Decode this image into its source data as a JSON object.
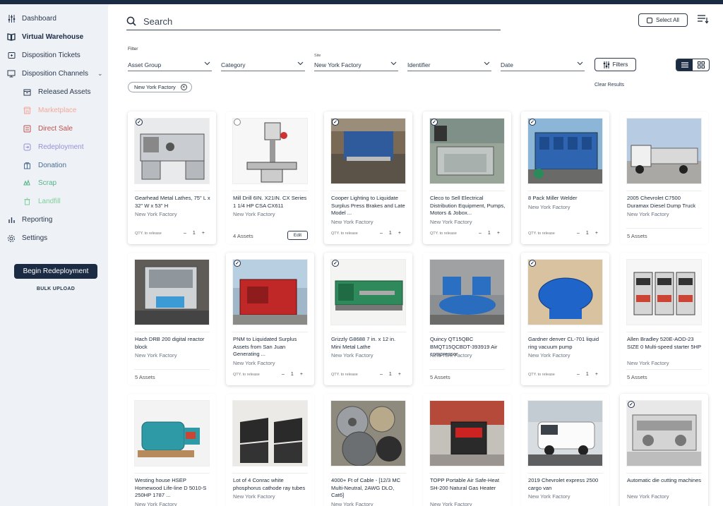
{
  "sidebar": {
    "items": [
      {
        "label": "Dashboard",
        "icon": "sliders-icon",
        "name": "dashboard",
        "level": "top",
        "color": "#2b3a4e"
      },
      {
        "label": "Virtual Warehouse",
        "icon": "book-icon",
        "name": "virtual-warehouse",
        "level": "top",
        "active": true,
        "color": "#1b2b44"
      },
      {
        "label": "Disposition Tickets",
        "icon": "ticket-icon",
        "name": "disposition-tickets",
        "level": "top",
        "color": "#2b3a4e"
      },
      {
        "label": "Disposition Channels",
        "icon": "monitor-icon",
        "name": "disposition-channels",
        "level": "top",
        "chevron": true,
        "color": "#2b3a4e"
      },
      {
        "label": "Released Assets",
        "icon": "box-icon",
        "name": "released-assets",
        "level": "sub",
        "color": "#2b3a4e"
      },
      {
        "label": "Marketplace",
        "icon": "store-icon",
        "name": "marketplace",
        "level": "sub",
        "color": "#f2a99a"
      },
      {
        "label": "Direct Sale",
        "icon": "tag-icon",
        "name": "direct-sale",
        "level": "sub",
        "color": "#c0504d"
      },
      {
        "label": "Redeployment",
        "icon": "redeploy-icon",
        "name": "redeployment",
        "level": "sub",
        "color": "#9b8fd8"
      },
      {
        "label": "Donation",
        "icon": "donation-icon",
        "name": "donation",
        "level": "sub",
        "color": "#4a6d93"
      },
      {
        "label": "Scrap",
        "icon": "recycle-icon",
        "name": "scrap",
        "level": "sub",
        "color": "#56b58a"
      },
      {
        "label": "Landfill",
        "icon": "trash-icon",
        "name": "landfill",
        "level": "sub",
        "color": "#7fd09a"
      },
      {
        "label": "Reporting",
        "icon": "bar-chart-icon",
        "name": "reporting",
        "level": "top",
        "color": "#2b3a4e"
      },
      {
        "label": "Settings",
        "icon": "gear-icon",
        "name": "settings",
        "level": "top",
        "color": "#2b3a4e"
      }
    ],
    "begin_label": "Begin Redeployment",
    "bulk_label": "BULK UPLOAD"
  },
  "search": {
    "placeholder": "Search"
  },
  "toolbar": {
    "select_all_label": "Select All",
    "filters_label": "Filters",
    "clear_label": "Clear Results"
  },
  "filter": {
    "label": "Filter",
    "dropdowns": [
      {
        "name": "asset-group",
        "value": "Asset Group",
        "top_label": ""
      },
      {
        "name": "category",
        "value": "Category",
        "top_label": ""
      },
      {
        "name": "site",
        "value": "New York Factory",
        "top_label": "Site"
      },
      {
        "name": "identifier",
        "value": "Identifier",
        "top_label": ""
      },
      {
        "name": "date",
        "value": "Date",
        "top_label": ""
      }
    ],
    "chip": "New York Factory"
  },
  "cards": [
    {
      "title": "Gearhead Metal Lathes, 75\" L x 32\" W x 53\" H",
      "location": "New York Factory",
      "mode": "qty",
      "checked": true,
      "qty_label": "QTY. to release",
      "qty": "1",
      "img": "lathe"
    },
    {
      "title": "Mill Drill 6IN. X21IN. CX Series 1 1/4 HP CSA CX611",
      "location": "New York Factory",
      "mode": "edit",
      "checked": false,
      "assets": "4 Assets",
      "edit_label": "Edit",
      "img": "drill"
    },
    {
      "title": "Cooper Lighting to Liquidate Surplus Press Brakes and Late Model ...",
      "location": "New York Factory",
      "mode": "qty",
      "checked": true,
      "qty_label": "QTY. to release",
      "qty": "1",
      "img": "press"
    },
    {
      "title": "Cleco to Sell Electrical Distribution Equipment, Pumps, Motors & Jobox...",
      "location": "New York Factory",
      "mode": "qty",
      "checked": true,
      "qty_label": "QTY. to release",
      "qty": "1",
      "img": "table"
    },
    {
      "title": "8 Pack Miller Welder",
      "location": "New York Factory",
      "mode": "qty",
      "checked": true,
      "qty_label": "QTY. to release",
      "qty": "1",
      "img": "welder"
    },
    {
      "title": "2005 Chevrolet C7500 Duramax Diesel Dump Truck",
      "location": "New York Factory",
      "mode": "assets",
      "checked": false,
      "assets": "5 Assets",
      "img": "truck"
    },
    {
      "title": "Hach DRB 200 digital reactor block",
      "location": "New York Factory",
      "mode": "assets",
      "checked": false,
      "assets": "5 Assets",
      "img": "reactor"
    },
    {
      "title": "PNM to Liquidated Surplus Assets from San Juan Generating ...",
      "location": "New York Factory",
      "mode": "qty",
      "checked": true,
      "qty_label": "QTY. to release",
      "qty": "1",
      "img": "generator"
    },
    {
      "title": "Grizzly G8688 7 in. x 12 in. Mini Metal Lathe",
      "location": "New York Factory",
      "mode": "qty",
      "checked": true,
      "qty_label": "QTY. to release",
      "qty": "1",
      "img": "minilathe"
    },
    {
      "title": "Quincy QT15QBC BMQT15QCBDT-393919 Air compressor",
      "location": "New York Factory",
      "mode": "assets",
      "checked": false,
      "assets": "5 Assets",
      "img": "compressor"
    },
    {
      "title": "Gardner denver CL-701 liquid ring vacuum pump",
      "location": "New York Factory",
      "mode": "qty",
      "checked": true,
      "qty_label": "QTY. to release",
      "qty": "1",
      "img": "pump"
    },
    {
      "title": "Allen Bradley 520E-AOD-23 SIZE 0 Multi-speed starter 5HP",
      "location": "New York Factory",
      "mode": "assets",
      "checked": false,
      "assets": "5 Assets",
      "img": "starter"
    },
    {
      "title": "Westing house HSEP Homewood Life-line D 5010-S 250HP 1787 ...",
      "location": "New York Factory",
      "mode": "none",
      "checked": false,
      "img": "motor"
    },
    {
      "title": "Lot of 4 Conrac white phosphorus cathode ray tubes",
      "location": "New York Factory",
      "mode": "none",
      "checked": false,
      "img": "crt"
    },
    {
      "title": "4000+ Ft of Cable - [12/3 MC Multi-Neutral, 2AWG DLO, Cat6]",
      "location": "New York Factory",
      "mode": "none",
      "checked": false,
      "img": "cable"
    },
    {
      "title": "TOPP Portable Air Safe-Heat SH-200 Natural Gas Heater",
      "location": "New York Factory",
      "mode": "none",
      "checked": false,
      "img": "heater"
    },
    {
      "title": "2019 Chevrolet express 2500 cargo van",
      "location": "New York Factory",
      "mode": "none",
      "checked": false,
      "img": "van"
    },
    {
      "title": "Automatic die cutting machines",
      "location": "New York Factory",
      "mode": "none",
      "checked": true,
      "img": "diecut"
    }
  ],
  "colors": {
    "navy": "#1b2b44",
    "accent_light": "#eef1f5"
  }
}
